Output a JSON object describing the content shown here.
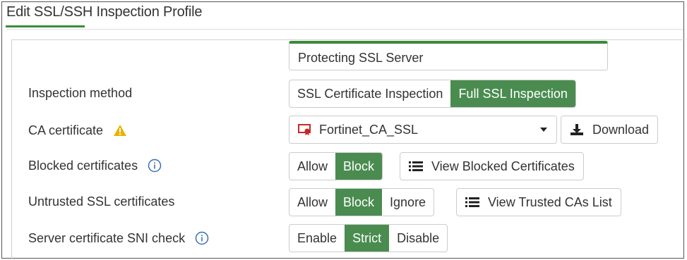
{
  "window": {
    "title": "Edit SSL/SSH Inspection Profile"
  },
  "profile": {
    "name": "Protecting SSL Server"
  },
  "inspection_method": {
    "label": "Inspection method",
    "options": [
      "SSL Certificate Inspection",
      "Full SSL Inspection"
    ],
    "selected": "Full SSL Inspection"
  },
  "ca_certificate": {
    "label": "CA certificate",
    "warning_icon": "warning-triangle-icon",
    "value": "Fortinet_CA_SSL",
    "download_label": "Download"
  },
  "blocked_certificates": {
    "label": "Blocked certificates",
    "options": [
      "Allow",
      "Block"
    ],
    "selected": "Block",
    "view_label": "View Blocked Certificates"
  },
  "untrusted_ssl": {
    "label": "Untrusted SSL certificates",
    "options": [
      "Allow",
      "Block",
      "Ignore"
    ],
    "selected": "Block",
    "view_label": "View Trusted CAs List"
  },
  "sni_check": {
    "label": "Server certificate SNI check",
    "options": [
      "Enable",
      "Strict",
      "Disable"
    ],
    "selected": "Strict"
  },
  "colors": {
    "accent": "#4a8c50",
    "warning": "#e8b300",
    "info": "#3a6fb0",
    "cert_red": "#c62828"
  }
}
